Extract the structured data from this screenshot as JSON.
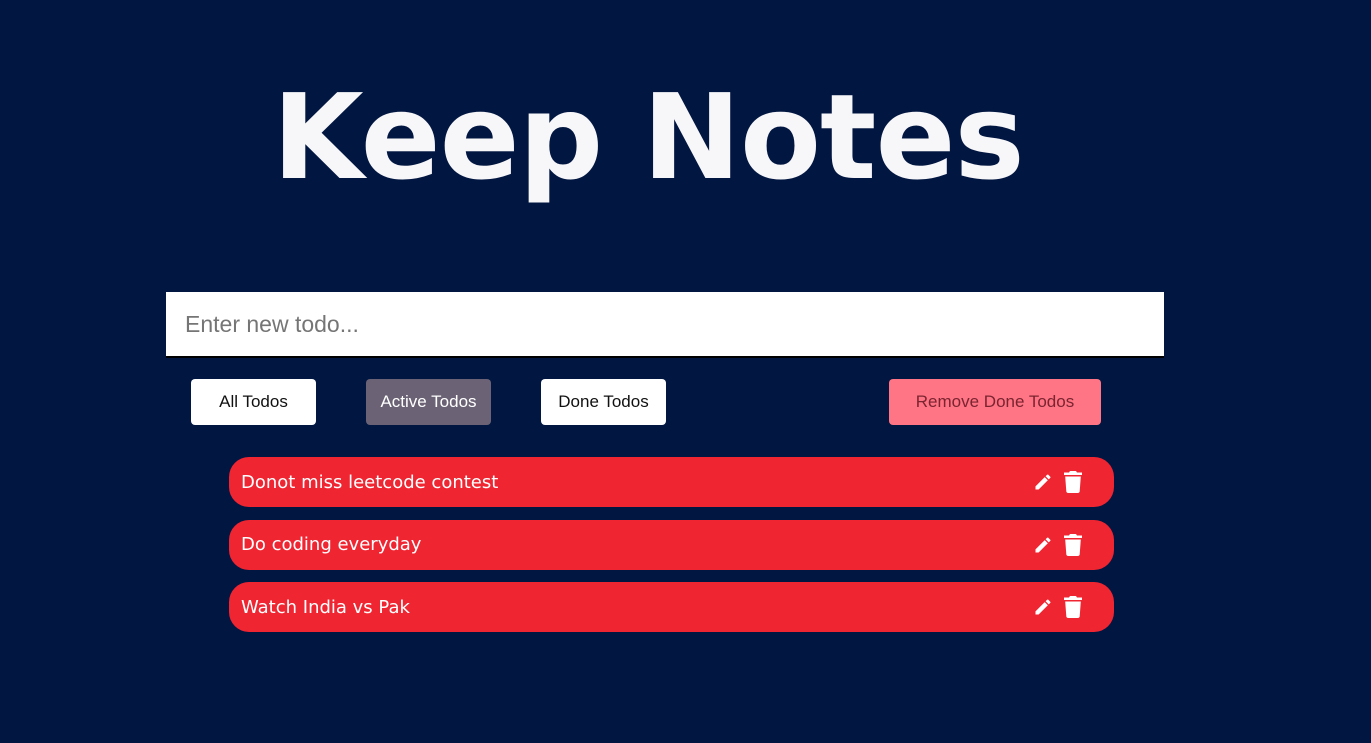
{
  "header": {
    "title": "Keep Notes"
  },
  "input": {
    "placeholder": "Enter new todo...",
    "value": ""
  },
  "filters": {
    "all_label": "All Todos",
    "active_label": "Active Todos",
    "done_label": "Done Todos",
    "remove_done_label": "Remove Done Todos",
    "selected": "Active Todos"
  },
  "todos": [
    {
      "text": "Donot miss leetcode contest",
      "edit_icon": "pencil-icon",
      "delete_icon": "trash-icon"
    },
    {
      "text": "Do coding everyday",
      "edit_icon": "pencil-icon",
      "delete_icon": "trash-icon"
    },
    {
      "text": "Watch India vs Pak",
      "edit_icon": "pencil-icon",
      "delete_icon": "trash-icon"
    }
  ],
  "colors": {
    "background": "#011640",
    "todo_item": "#f02532",
    "active_filter": "#6b6375",
    "remove_button": "#ff7585"
  }
}
